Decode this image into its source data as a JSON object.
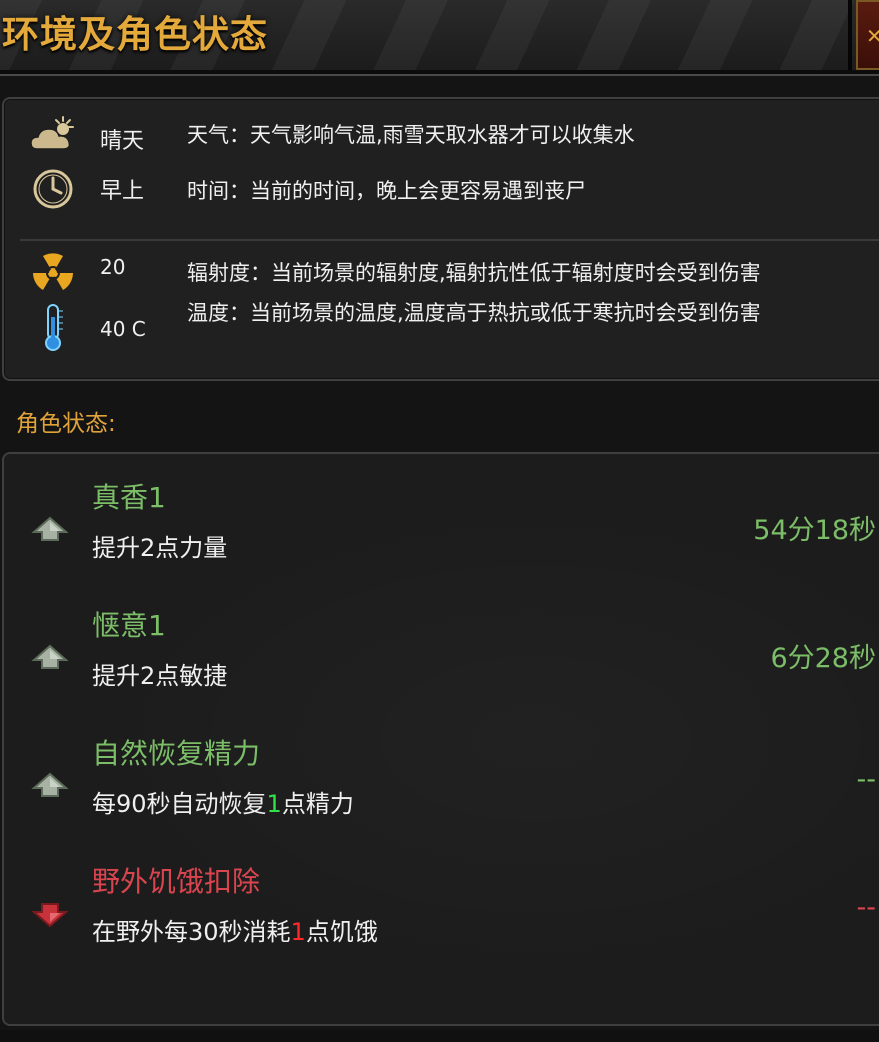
{
  "header": {
    "title": "环境及角色状态",
    "corner_glyph": "✕"
  },
  "environment": {
    "weather": {
      "icon": "partly-cloudy-icon",
      "value": "晴天",
      "description": "天气：天气影响气温,雨雪天取水器才可以收集水"
    },
    "time": {
      "icon": "clock-icon",
      "value": "早上",
      "description": "时间：当前的时间，晚上会更容易遇到丧尸"
    },
    "radiation": {
      "icon": "radiation-icon",
      "value": "20",
      "description": "辐射度：当前场景的辐射度,辐射抗性低于辐射度时会受到伤害"
    },
    "temperature": {
      "icon": "thermometer-icon",
      "value": "40 C",
      "description": "温度：当前场景的温度,温度高于热抗或低于寒抗时会受到伤害"
    }
  },
  "status_heading": "角色状态:",
  "statuses": [
    {
      "type": "buff",
      "icon": "arrow-up-icon",
      "name": "真香1",
      "desc_before": "提升2点力量",
      "desc_highlight": "",
      "desc_after": "",
      "time": "54分18秒"
    },
    {
      "type": "buff",
      "icon": "arrow-up-icon",
      "name": "惬意1",
      "desc_before": "提升2点敏捷",
      "desc_highlight": "",
      "desc_after": "",
      "time": "6分28秒"
    },
    {
      "type": "buff",
      "icon": "arrow-up-icon",
      "name": "自然恢复精力",
      "desc_before": "每90秒自动恢复",
      "desc_highlight": "1",
      "desc_after": "点精力",
      "time": "--"
    },
    {
      "type": "debuff",
      "icon": "arrow-down-icon",
      "name": "野外饥饿扣除",
      "desc_before": "在野外每30秒消耗",
      "desc_highlight": "1",
      "desc_after": "点饥饿",
      "time": "--"
    }
  ],
  "colors": {
    "title_gold": "#e4a93b",
    "buff_green": "#7cbd68",
    "debuff_red": "#d9454f",
    "highlight_green": "#33e14a",
    "highlight_red": "#ff2a2a"
  }
}
